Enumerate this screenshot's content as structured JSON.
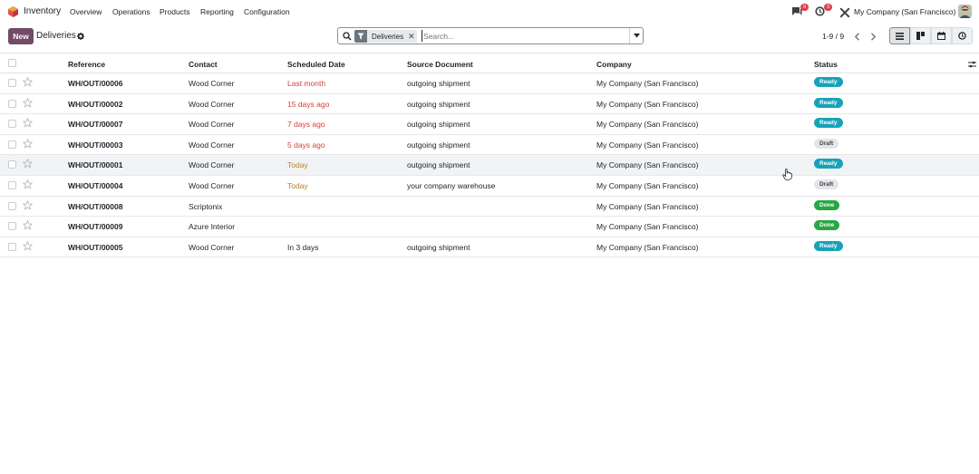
{
  "navbar": {
    "app_name": "Inventory",
    "menus": [
      "Overview",
      "Operations",
      "Products",
      "Reporting",
      "Configuration"
    ],
    "messages_count": "9",
    "activities_count": "3",
    "company": "My Company (San Francisco)"
  },
  "control": {
    "new_label": "New",
    "breadcrumb": "Deliveries",
    "facet_label": "Deliveries",
    "search_placeholder": "Search...",
    "pager": "1-9 / 9"
  },
  "columns": [
    "Reference",
    "Contact",
    "Scheduled Date",
    "Source Document",
    "Company",
    "Status"
  ],
  "rows": [
    {
      "reference": "WH/OUT/00006",
      "contact": "Wood Corner",
      "scheduled": "Last month",
      "date_state": "late",
      "source": "outgoing shipment",
      "company": "My Company (San Francisco)",
      "status": "Ready"
    },
    {
      "reference": "WH/OUT/00002",
      "contact": "Wood Corner",
      "scheduled": "15 days ago",
      "date_state": "late",
      "source": "outgoing shipment",
      "company": "My Company (San Francisco)",
      "status": "Ready"
    },
    {
      "reference": "WH/OUT/00007",
      "contact": "Wood Corner",
      "scheduled": "7 days ago",
      "date_state": "late",
      "source": "outgoing shipment",
      "company": "My Company (San Francisco)",
      "status": "Ready"
    },
    {
      "reference": "WH/OUT/00003",
      "contact": "Wood Corner",
      "scheduled": "5 days ago",
      "date_state": "late",
      "source": "outgoing shipment",
      "company": "My Company (San Francisco)",
      "status": "Draft"
    },
    {
      "reference": "WH/OUT/00001",
      "contact": "Wood Corner",
      "scheduled": "Today",
      "date_state": "today",
      "source": "outgoing shipment",
      "company": "My Company (San Francisco)",
      "status": "Ready"
    },
    {
      "reference": "WH/OUT/00004",
      "contact": "Wood Corner",
      "scheduled": "Today",
      "date_state": "today",
      "source": "your company warehouse",
      "company": "My Company (San Francisco)",
      "status": "Draft"
    },
    {
      "reference": "WH/OUT/00008",
      "contact": "Scriptonix",
      "scheduled": "",
      "date_state": "none",
      "source": "",
      "company": "My Company (San Francisco)",
      "status": "Done"
    },
    {
      "reference": "WH/OUT/00009",
      "contact": "Azure Interior",
      "scheduled": "",
      "date_state": "none",
      "source": "",
      "company": "My Company (San Francisco)",
      "status": "Done"
    },
    {
      "reference": "WH/OUT/00005",
      "contact": "Wood Corner",
      "scheduled": "In 3 days",
      "date_state": "future",
      "source": "outgoing shipment",
      "company": "My Company (San Francisco)",
      "status": "Ready"
    }
  ],
  "colors": {
    "brand": "#714b67",
    "late": "#d23f3a",
    "today": "#b6831e",
    "ready": "#17a2b8",
    "done": "#28a745",
    "draft": "#e3e5e8"
  }
}
